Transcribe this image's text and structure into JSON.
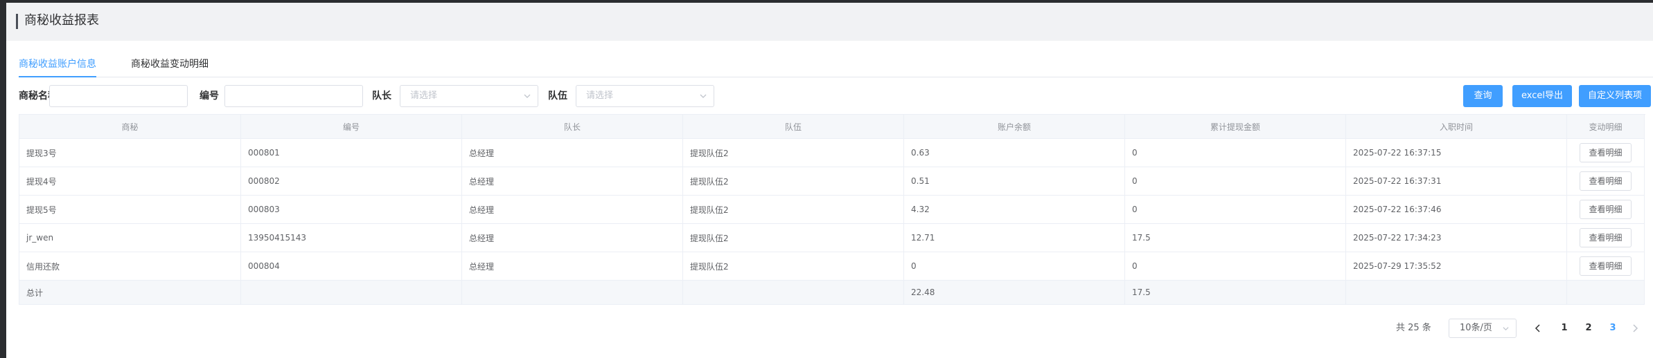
{
  "page": {
    "title": "商秘收益报表"
  },
  "tabs": [
    {
      "label": "商秘收益账户信息",
      "active": true
    },
    {
      "label": "商秘收益变动明细",
      "active": false
    }
  ],
  "filters": {
    "name_label": "商秘名称",
    "name_value": "",
    "code_label": "编号",
    "code_value": "",
    "leader_label": "队长",
    "leader_placeholder": "请选择",
    "team_label": "队伍",
    "team_placeholder": "请选择"
  },
  "actions": {
    "query": "查询",
    "export": "excel导出",
    "custom_columns": "自定义列表项"
  },
  "table": {
    "headers": [
      "商秘",
      "编号",
      "队长",
      "队伍",
      "账户余额",
      "累计提现金额",
      "入职时间",
      "变动明细"
    ],
    "rows": [
      {
        "name": "提现3号",
        "code": "000801",
        "leader": "总经理",
        "team": "提现队伍2",
        "balance": "0.63",
        "withdrawn": "0",
        "joined": "2025-07-22 16:37:15",
        "action": "查看明细"
      },
      {
        "name": "提现4号",
        "code": "000802",
        "leader": "总经理",
        "team": "提现队伍2",
        "balance": "0.51",
        "withdrawn": "0",
        "joined": "2025-07-22 16:37:31",
        "action": "查看明细"
      },
      {
        "name": "提现5号",
        "code": "000803",
        "leader": "总经理",
        "team": "提现队伍2",
        "balance": "4.32",
        "withdrawn": "0",
        "joined": "2025-07-22 16:37:46",
        "action": "查看明细"
      },
      {
        "name": "jr_wen",
        "code": "13950415143",
        "leader": "总经理",
        "team": "提现队伍2",
        "balance": "12.71",
        "withdrawn": "17.5",
        "joined": "2025-07-22 17:34:23",
        "action": "查看明细"
      },
      {
        "name": "信用还款",
        "code": "000804",
        "leader": "总经理",
        "team": "提现队伍2",
        "balance": "0",
        "withdrawn": "0",
        "joined": "2025-07-29 17:35:52",
        "action": "查看明细"
      }
    ],
    "footer": {
      "label": "总计",
      "balance": "22.48",
      "withdrawn": "17.5"
    }
  },
  "pagination": {
    "total_text": "共 25 条",
    "page_size": "10条/页",
    "pages": [
      "1",
      "2",
      "3"
    ],
    "current": 3
  },
  "colors": {
    "accent": "#409eff",
    "header_bg": "#f1f2f4",
    "table_header_bg": "#f5f7fa"
  },
  "icons": [
    "chevron-down-icon",
    "chevron-left-icon",
    "chevron-right-icon"
  ]
}
